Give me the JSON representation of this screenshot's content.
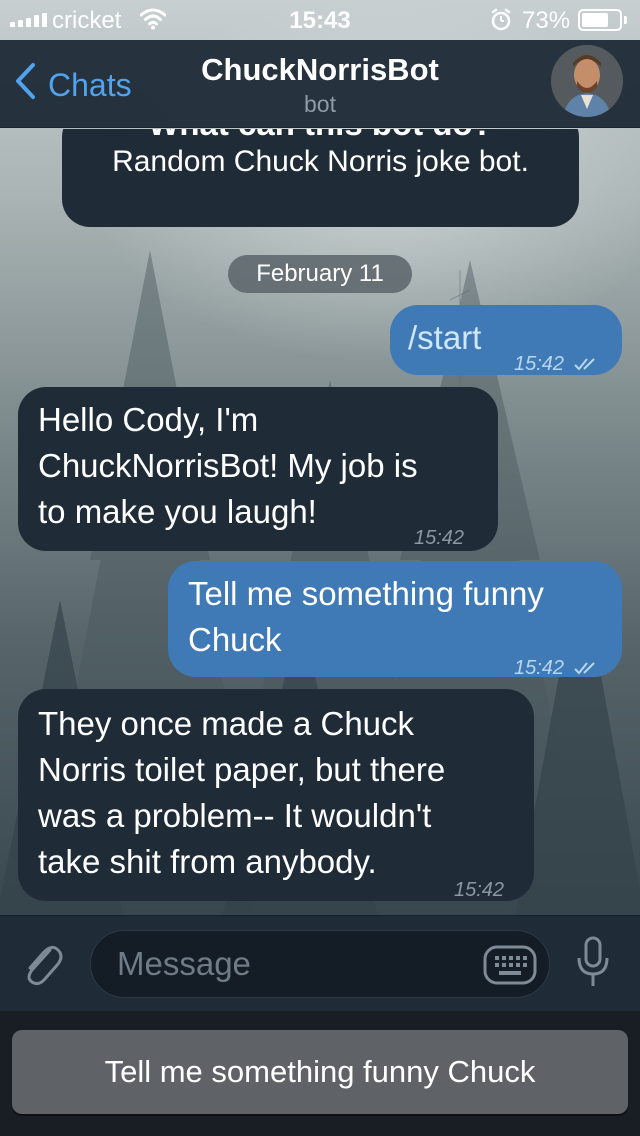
{
  "status_bar": {
    "carrier": "cricket",
    "time": "15:43",
    "battery": "73%",
    "battery_level": 0.73
  },
  "nav": {
    "back_label": "Chats",
    "title": "ChuckNorrisBot",
    "subtitle": "bot"
  },
  "info": {
    "heading": "What can this bot do?",
    "description": "Random Chuck Norris joke bot."
  },
  "date_separator": "February 11",
  "messages": [
    {
      "direction": "out",
      "lines": [
        "/start"
      ],
      "time": "15:42",
      "read": true
    },
    {
      "direction": "in",
      "lines": [
        "Hello Cody, I'm",
        "ChuckNorrisBot! My job is",
        "to make you laugh!"
      ],
      "time": "15:42"
    },
    {
      "direction": "out",
      "lines": [
        "Tell me something funny",
        "Chuck"
      ],
      "time": "15:42",
      "read": true
    },
    {
      "direction": "in",
      "lines": [
        "They once made a Chuck",
        "Norris toilet paper, but there",
        "was a problem-- It wouldn't",
        "take shit from anybody."
      ],
      "time": "15:42"
    }
  ],
  "input": {
    "placeholder": "Message"
  },
  "reply_keyboard": {
    "button_label": "Tell me something funny Chuck"
  },
  "colors": {
    "accent": "#4fa3ef",
    "incoming_bubble": "#1f2c38",
    "outgoing_bubble": "#3f7ab7"
  },
  "icons": [
    "signal-icon",
    "wifi-icon",
    "alarm-icon",
    "battery-icon",
    "back-chevron-icon",
    "attach-icon",
    "keyboard-icon",
    "mic-icon",
    "double-check-icon"
  ]
}
